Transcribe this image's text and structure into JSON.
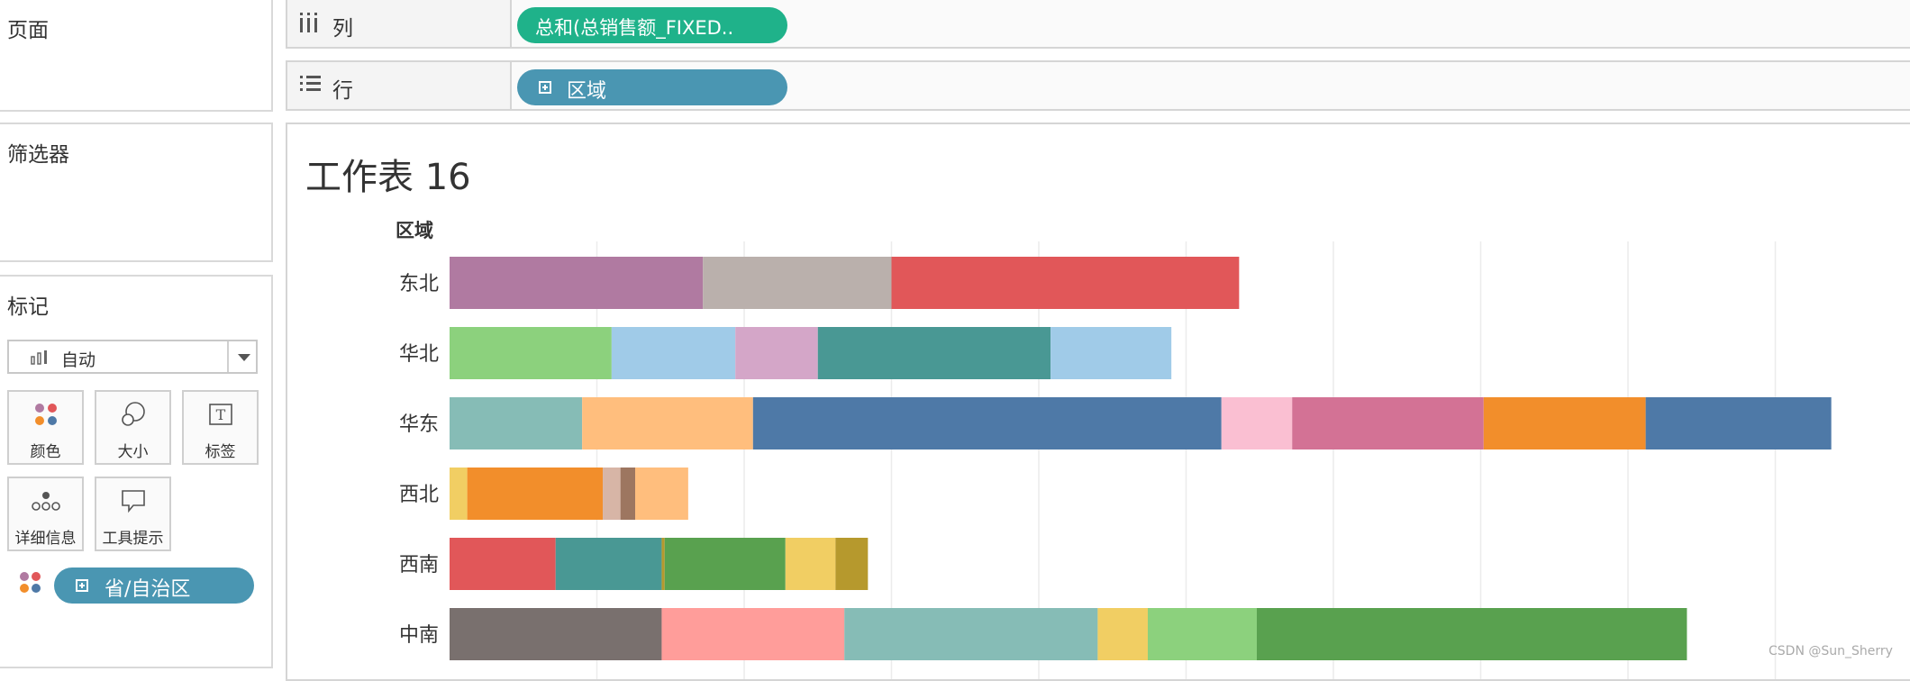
{
  "sidebar": {
    "pages_title": "页面",
    "filters_title": "筛选器",
    "marks_title": "标记",
    "marks_type": "自动",
    "mark_buttons": [
      {
        "label": "颜色",
        "icon": "color-icon"
      },
      {
        "label": "大小",
        "icon": "size-icon"
      },
      {
        "label": "标签",
        "icon": "label-icon"
      },
      {
        "label": "详细信息",
        "icon": "detail-icon"
      },
      {
        "label": "工具提示",
        "icon": "tooltip-icon"
      }
    ],
    "color_field": "省/自治区"
  },
  "shelves": {
    "columns_label": "列",
    "columns_pill": "总和(总销售额_FIXED..",
    "rows_label": "行",
    "rows_pill": "区域"
  },
  "colors": {
    "columns_pill": "#1fb28a",
    "rows_pill": "#4a96b2"
  },
  "view": {
    "title": "工作表 16",
    "row_header": "区域"
  },
  "chart_data": {
    "type": "bar",
    "orientation": "horizontal",
    "stacked": true,
    "categories": [
      "东北",
      "华北",
      "华东",
      "西北",
      "西南",
      "中南"
    ],
    "bars": [
      [
        {
          "value": 86,
          "color": "#b07aa1"
        },
        {
          "value": 64,
          "color": "#bab0ac"
        },
        {
          "value": 118,
          "color": "#e15759"
        }
      ],
      [
        {
          "value": 55,
          "color": "#8cd17d"
        },
        {
          "value": 42,
          "color": "#a0cbe8"
        },
        {
          "value": 28,
          "color": "#d4a6c8"
        },
        {
          "value": 79,
          "color": "#499894"
        },
        {
          "value": 41,
          "color": "#a0cbe8"
        }
      ],
      [
        {
          "value": 45,
          "color": "#86bcb6"
        },
        {
          "value": 58,
          "color": "#ffbe7d"
        },
        {
          "value": 159,
          "color": "#4e79a7"
        },
        {
          "value": 24,
          "color": "#fabfd2"
        },
        {
          "value": 65,
          "color": "#d37295"
        },
        {
          "value": 55,
          "color": "#f28e2b"
        },
        {
          "value": 63,
          "color": "#4e79a7"
        }
      ],
      [
        {
          "value": 6,
          "color": "#f1ce63"
        },
        {
          "value": 46,
          "color": "#f28e2b"
        },
        {
          "value": 6,
          "color": "#d7b5a6"
        },
        {
          "value": 5,
          "color": "#9d7660"
        },
        {
          "value": 18,
          "color": "#ffbe7d"
        }
      ],
      [
        {
          "value": 36,
          "color": "#e15759"
        },
        {
          "value": 36,
          "color": "#499894"
        },
        {
          "value": 1,
          "color": "#b6992d"
        },
        {
          "value": 41,
          "color": "#59a14f"
        },
        {
          "value": 17,
          "color": "#f1ce63"
        },
        {
          "value": 11,
          "color": "#b6992d"
        }
      ],
      [
        {
          "value": 72,
          "color": "#79706e"
        },
        {
          "value": 62,
          "color": "#ff9d9a"
        },
        {
          "value": 86,
          "color": "#86bcb6"
        },
        {
          "value": 17,
          "color": "#f1ce63"
        },
        {
          "value": 37,
          "color": "#8cd17d"
        },
        {
          "value": 146,
          "color": "#59a14f"
        }
      ]
    ],
    "xlim": [
      0,
      500
    ],
    "grid_step": 50,
    "grid": true
  },
  "watermark": "CSDN @Sun_Sherry"
}
